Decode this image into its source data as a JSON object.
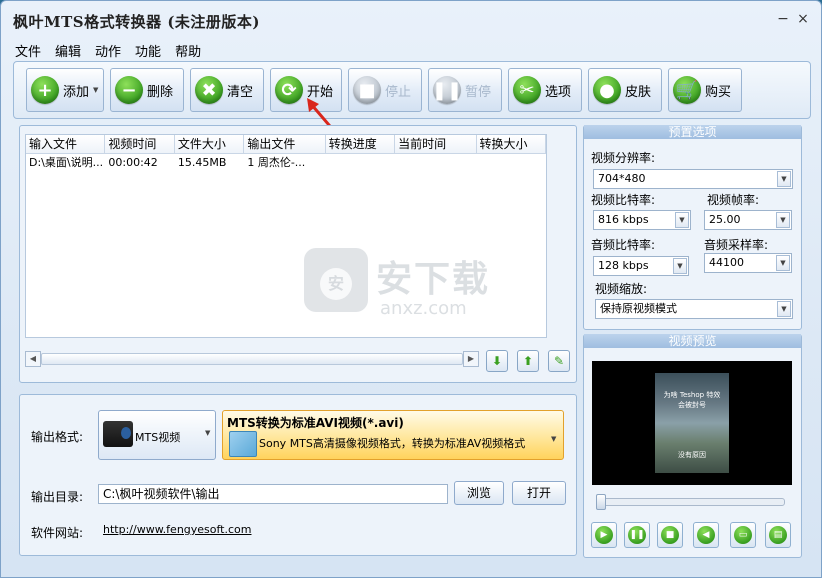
{
  "window": {
    "title": "枫叶MTS格式转换器  (未注册版本)",
    "minimize": "−",
    "close": "×"
  },
  "menu": [
    "文件",
    "编辑",
    "动作",
    "功能",
    "帮助"
  ],
  "toolbar": {
    "add": "添加",
    "delete": "删除",
    "clear": "清空",
    "start": "开始",
    "stop": "停止",
    "pause": "暂停",
    "options": "选项",
    "skin": "皮肤",
    "buy": "购买"
  },
  "file_list": {
    "columns": [
      "输入文件",
      "视频时间",
      "文件大小",
      "输出文件",
      "转换进度",
      "当前时间",
      "转换大小"
    ],
    "rows": [
      [
        "D:\\桌面\\说明...",
        "00:00:42",
        "15.45MB",
        "1 周杰伦-...",
        "",
        "",
        ""
      ]
    ]
  },
  "preset": {
    "title": "预置选项",
    "resolution_label": "视频分辨率:",
    "resolution": "704*480",
    "vbitrate_label": "视频比特率:",
    "vbitrate": "816 kbps",
    "fps_label": "视频帧率:",
    "fps": "25.00",
    "abitrate_label": "音频比特率:",
    "abitrate": "128 kbps",
    "samplerate_label": "音频采样率:",
    "samplerate": "44100",
    "scale_label": "视频缩放:",
    "scale": "保持原视频模式"
  },
  "preview": {
    "title": "视频预览",
    "lines_top": [
      "为啥 Teshop 特效",
      "会被封号"
    ],
    "line_bottom": "没有原因"
  },
  "output": {
    "format_label": "输出格式:",
    "format_button": "MTS视频",
    "format_title": "MTS转换为标准AVI视频(*.avi)",
    "format_desc": "Sony MTS高清摄像视频格式，转换为标准AV视频格式",
    "dir_label": "输出目录:",
    "dir_value": "C:\\枫叶视频软件\\输出",
    "browse": "浏览",
    "open": "打开",
    "site_label": "软件网站:",
    "site_url": "http://www.fengyesoft.com"
  },
  "watermark": {
    "text_cn": "安下载",
    "text_en": "anxz.com"
  },
  "colors": {
    "accent_green": "#3aa021",
    "highlight_yellow": "#ffd35c",
    "arrow_red": "#d9261c"
  }
}
